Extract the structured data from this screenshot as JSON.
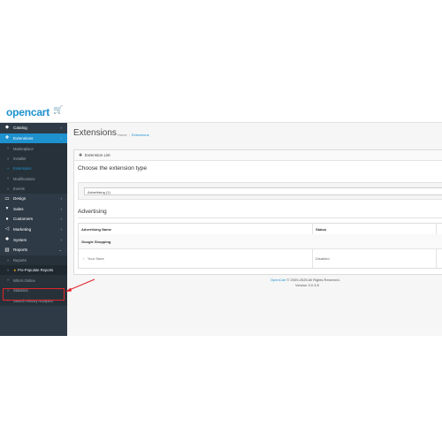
{
  "app": {
    "logo_text": "opencart"
  },
  "sidebar": {
    "catalog": "Catalog",
    "extensions": "Extensions",
    "ext_sub": [
      "Marketplace",
      "Installer",
      "Extensions",
      "Modifications",
      "Events"
    ],
    "design": "Design",
    "sales": "Sales",
    "customers": "Customers",
    "marketing": "Marketing",
    "system": "System",
    "reports": "Reports",
    "rep_sub": [
      "Reports",
      "Pre-Populate Reports",
      "Who's Online",
      "Statistics",
      "Search History Analytics"
    ]
  },
  "header": {
    "title": "Extensions",
    "breadcrumb": [
      "Home",
      "Extensions"
    ]
  },
  "panel": {
    "heading": "Extension List",
    "choose_title": "Choose the extension type",
    "select_value": "Advertising (1)",
    "section_title": "Advertising",
    "columns": [
      "Advertising Name",
      "Status"
    ],
    "group": "Google Shopping",
    "rows": [
      {
        "name": "Your Store",
        "status": "Disabled"
      }
    ]
  },
  "footer": {
    "brand": "OpenCart",
    "copyright": "© 2009-2025 All Rights Reserved.",
    "version": "Version 3.0.3.8"
  },
  "colors": {
    "accent": "#1e91cf",
    "sidebar": "#2e3a46",
    "highlight": "#e2242a"
  }
}
